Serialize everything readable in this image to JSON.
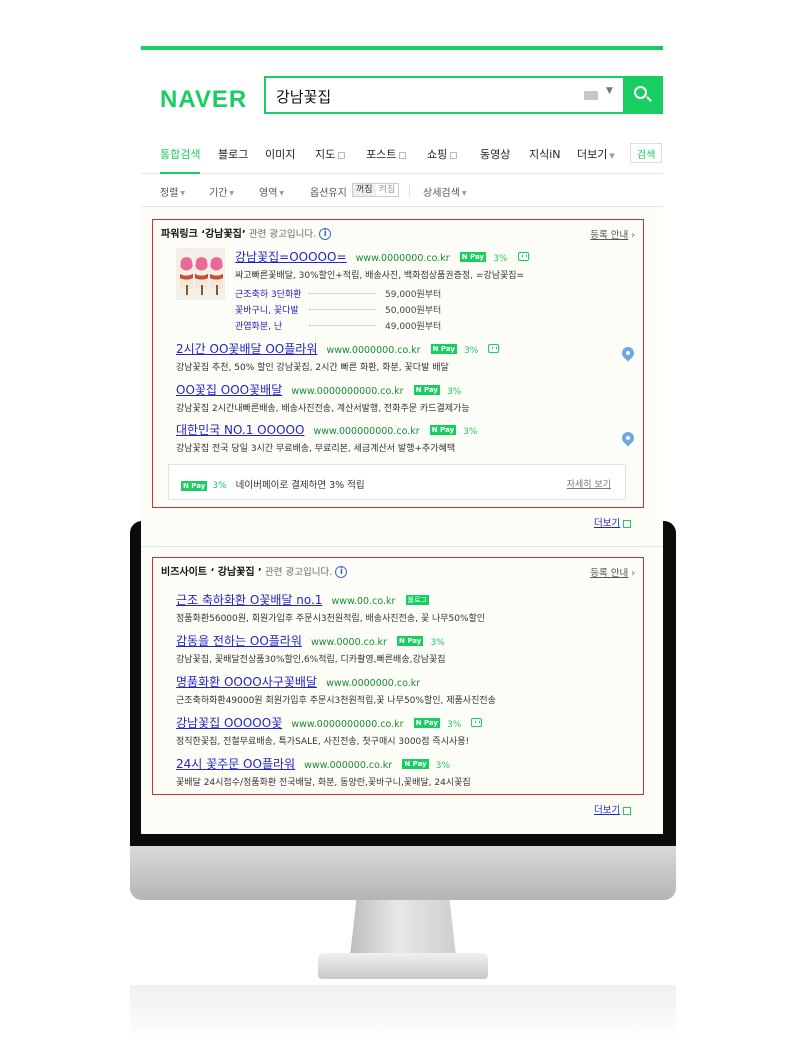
{
  "search": {
    "logo": "NAVER",
    "query": "강남꽃집"
  },
  "tabs": [
    {
      "label": "통합검색",
      "active": true
    },
    {
      "label": "블로그"
    },
    {
      "label": "이미지"
    },
    {
      "label": "지도"
    },
    {
      "label": "포스트"
    },
    {
      "label": "쇼핑"
    },
    {
      "label": "동영상"
    },
    {
      "label": "지식iN"
    },
    {
      "label": "더보기"
    },
    {
      "label": "검색"
    }
  ],
  "options": {
    "sort": "정렬",
    "period": "기간",
    "area": "영역",
    "keep": "옵션유지",
    "toggle_on": "꺼짐",
    "toggle_off": "켜짐",
    "detail": "상세검색"
  },
  "powerlink": {
    "title": "파워링크 ‘강남꽃집’",
    "note": "관련 광고입니다.",
    "register": "등록 안내",
    "ads": [
      {
        "title": "강남꽃집=OOOOO=",
        "url": "www.0000000.co.kr",
        "pct": "3%",
        "desc": "싸고빠른꽃배달, 30%할인+적립, 배송사진, 백화점상품권증정, =강남꽃집=",
        "prices": [
          {
            "name": "근조축하 3단화환",
            "price": "59,000원부터"
          },
          {
            "name": "꽃바구니, 꽃다발",
            "price": "50,000원부터"
          },
          {
            "name": "관엽화분, 난",
            "price": "49,000원부터"
          }
        ]
      },
      {
        "title": "2시간 OO꽃배달 OO플라워",
        "url": "www.0000000.co.kr",
        "pct": "3%",
        "desc": "강남꽃집 추천, 50% 할인 강남꽃집, 2시간 빠른 화환, 화분, 꽃다발 배달"
      },
      {
        "title": "OO꽃집 OOO꽃배달",
        "url": "www.0000000000.co.kr",
        "pct": "3%",
        "desc": "강남꽃집 2시간내빠른배송, 배송사진전송, 계산서발행, 전화주문 카드결제가능"
      },
      {
        "title": "대한민국 NO.1 OOOOO",
        "url": "www.000000000.co.kr",
        "pct": "3%",
        "desc": "강남꽃집 전국 당일 3시간 무료배송, 무료리본, 세금계산서 발행+추가혜택"
      }
    ],
    "pay_bar": {
      "pct": "3%",
      "text": "네이버페이로 결제하면 3% 적립",
      "detail": "자세히 보기"
    },
    "more": "더보기"
  },
  "bizsite": {
    "title": "비즈사이트 ‘ 강남꽃집 ’",
    "note": "관련 광고입니다.",
    "register": "등록 안내",
    "ads": [
      {
        "title": "근조 축하화환 O꽃배달 no.1",
        "url": "www.00.co.kr",
        "badge": "블로그",
        "desc": "정품화환56000원, 회원가입후 주문시3천원적립, 배송사진전송, 꽃 나무50%할인"
      },
      {
        "title": "감동을 전하는 OO플라워",
        "url": "www.0000.co.kr",
        "pct": "3%",
        "desc": "강남꽃집, 꽃배달전상품30%할인,6%적립, 디카촬영,빠른배송,강남꽃집"
      },
      {
        "title": "명품화환 OOOO사구꽃배달",
        "url": "www.0000000.co.kr",
        "desc": "근조축하화환49000원 회원가입후 주문시3천원적립,꽃 나무50%할인, 제품사진전송"
      },
      {
        "title": "강남꽃집 OOOOO꽃",
        "url": "www.0000000000.co.kr",
        "pct": "3%",
        "desc": "정직한꽃집, 전철무료배송, 특가SALE, 사진전송, 첫구매시 3000점 즉시사용!"
      },
      {
        "title": "24시 꽃주문 OO플라워",
        "url": "www.000000.co.kr",
        "pct": "3%",
        "desc": "꽃배달 24시접수/정품화환 전국배달, 화분, 동양란,꽃바구니,꽃배달, 24시꽃집"
      }
    ],
    "more": "더보기"
  },
  "npay_label": "N Pay",
  "colors": {
    "naver_green": "#19ce60",
    "ad_border": "#d53030",
    "link_blue": "#2424c8",
    "url_green": "#1a8a3a"
  }
}
